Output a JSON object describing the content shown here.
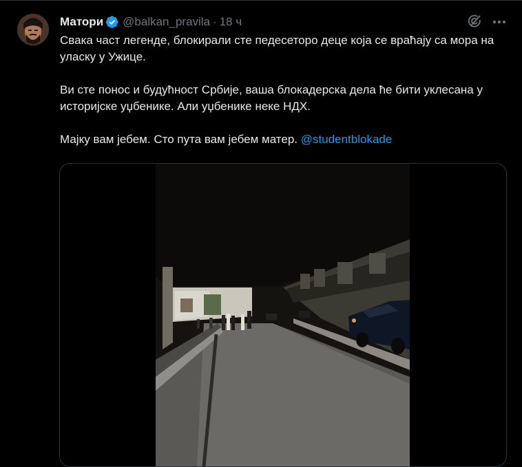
{
  "tweet": {
    "author_name": "Матори",
    "handle": "@balkan_pravila",
    "separator": "·",
    "time": "18 ч",
    "paragraphs": [
      "Свака част легенде, блокирали сте педесеторо деце која се враћају са мора на уласку у Ужице.",
      "Ви сте понос и будућност Србије, ваша блокадерска дела ће бити уклесана у историјске уџбенике. Али уџбенике неке НДХ."
    ],
    "last_line_text": "Мајку вам јебем. Сто пута вам јебем матер. ",
    "mention": "@studentblokade"
  },
  "icons": {
    "verified": "verified-badge-icon",
    "grok": "grok-icon",
    "more": "more-icon"
  },
  "colors": {
    "background": "#000000",
    "text": "#e7e9ea",
    "secondary": "#71767b",
    "link": "#1d9bf0",
    "border": "#2f3336"
  }
}
